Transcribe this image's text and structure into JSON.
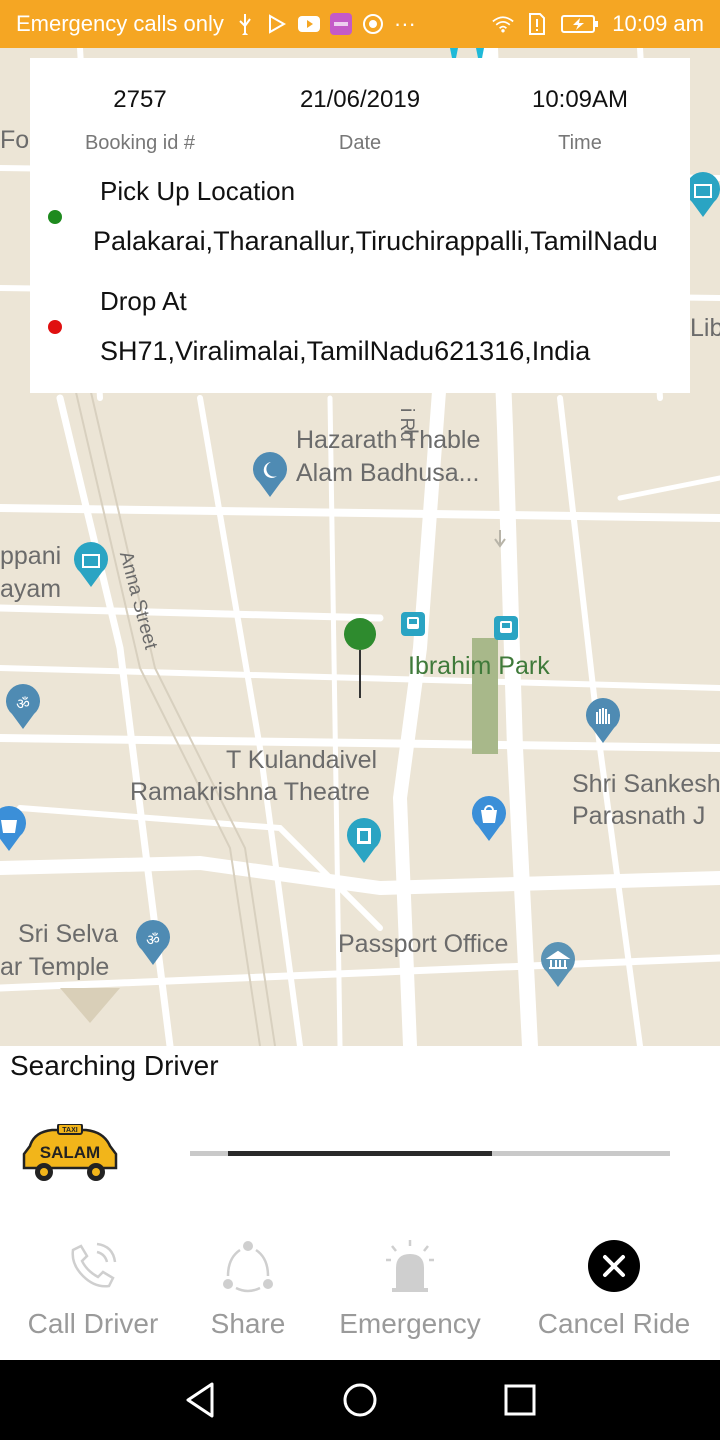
{
  "status_bar": {
    "carrier_text": "Emergency calls only",
    "time": "10:09 am",
    "overflow": "···",
    "icons": [
      "usb-icon",
      "play-icon",
      "youtube-icon",
      "app-icon",
      "chrome-icon",
      "wifi-icon",
      "sim-alert-icon",
      "battery-charging-icon"
    ]
  },
  "map": {
    "labels": {
      "hazarath_1": "Hazarath Thable",
      "hazarath_2": "Alam Badhusa...",
      "anna_street": "Anna Street",
      "ibrahim_park": "Ibrahim Park",
      "kulandaivel_1": "T Kulandaivel",
      "kulandaivel_2": "Ramakrishna Theatre",
      "sankesh_1": "Shri Sankesh",
      "sankesh_2": "Parasnath J",
      "selva_1": "Sri Selva",
      "selva_2": "ar Temple",
      "passport": "Passport Office",
      "ppani_1": "ppani",
      "ppani_2": "ayam",
      "rd": "i Rd",
      "lib": "Lib",
      "for": "For"
    },
    "colors": {
      "road": "#ffffff",
      "land": "#ece5d6",
      "poi_blue": "#2aa4c3",
      "pin_green": "#2e8b2e"
    }
  },
  "booking": {
    "booking_id": "2757",
    "booking_id_caption": "Booking id #",
    "date": "21/06/2019",
    "date_caption": "Date",
    "time": "10:09AM",
    "time_caption": "Time",
    "pickup_title": "Pick Up Location",
    "pickup_address": "Palakarai,Tharanallur,Tiruchirappalli,TamilNadu",
    "drop_title": "Drop At",
    "drop_address": "SH71,Viralimalai,TamilNadu621316,India",
    "pickup_color": "#1e8a1e",
    "drop_color": "#e01010"
  },
  "sheet": {
    "title": "Searching Driver",
    "logo_text_top": "TAXI",
    "logo_text_main": "SALAM",
    "progress": 0.63,
    "actions": [
      {
        "label": "Call Driver",
        "icon": "phone-icon"
      },
      {
        "label": "Share",
        "icon": "share-icon"
      },
      {
        "label": "Emergency",
        "icon": "alarm-bell-icon"
      },
      {
        "label": "Cancel Ride",
        "icon": "close-circle-icon"
      }
    ]
  },
  "nav_bar": {
    "buttons": [
      "back-icon",
      "home-icon",
      "recents-icon"
    ]
  }
}
